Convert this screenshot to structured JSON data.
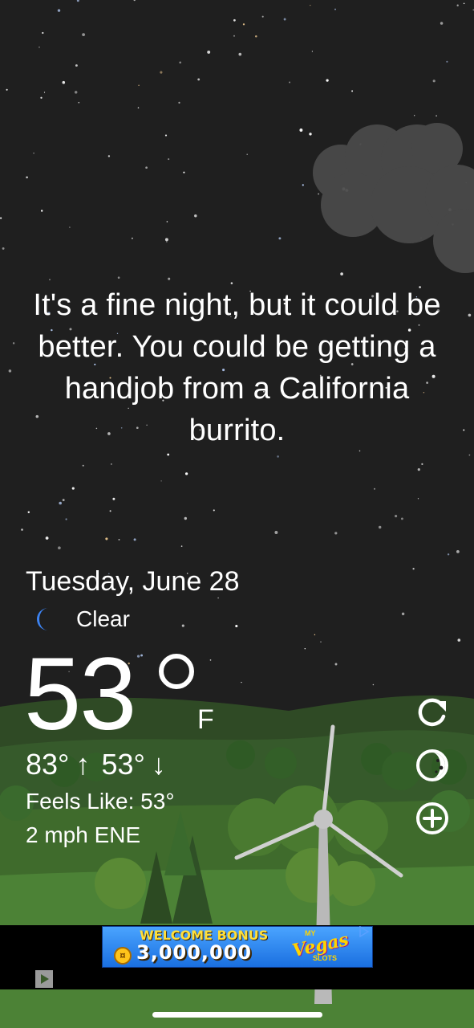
{
  "weather": {
    "quote": "It's a fine night, but it could be better. You could be getting a handjob from a California burrito.",
    "date": "Tuesday, June 28",
    "condition_icon": "crescent-moon-icon",
    "condition": "Clear",
    "temperature": "53",
    "unit": "F",
    "high": "83°",
    "low": "53°",
    "feels_like": "Feels Like: 53°",
    "wind": "2 mph ENE"
  },
  "actions": [
    {
      "name": "refresh-icon"
    },
    {
      "name": "moon-phase-icon"
    },
    {
      "name": "add-location-icon"
    }
  ],
  "ad": {
    "line1": "WELCOME BONUS",
    "line2": "3,000,000",
    "logo_my": "MY",
    "logo_main": "Vegas",
    "logo_sub": "SLOTS"
  },
  "colors": {
    "sky": "#1f1f1f",
    "grass": "#3f6b2c",
    "moon": "#3c82f0"
  }
}
